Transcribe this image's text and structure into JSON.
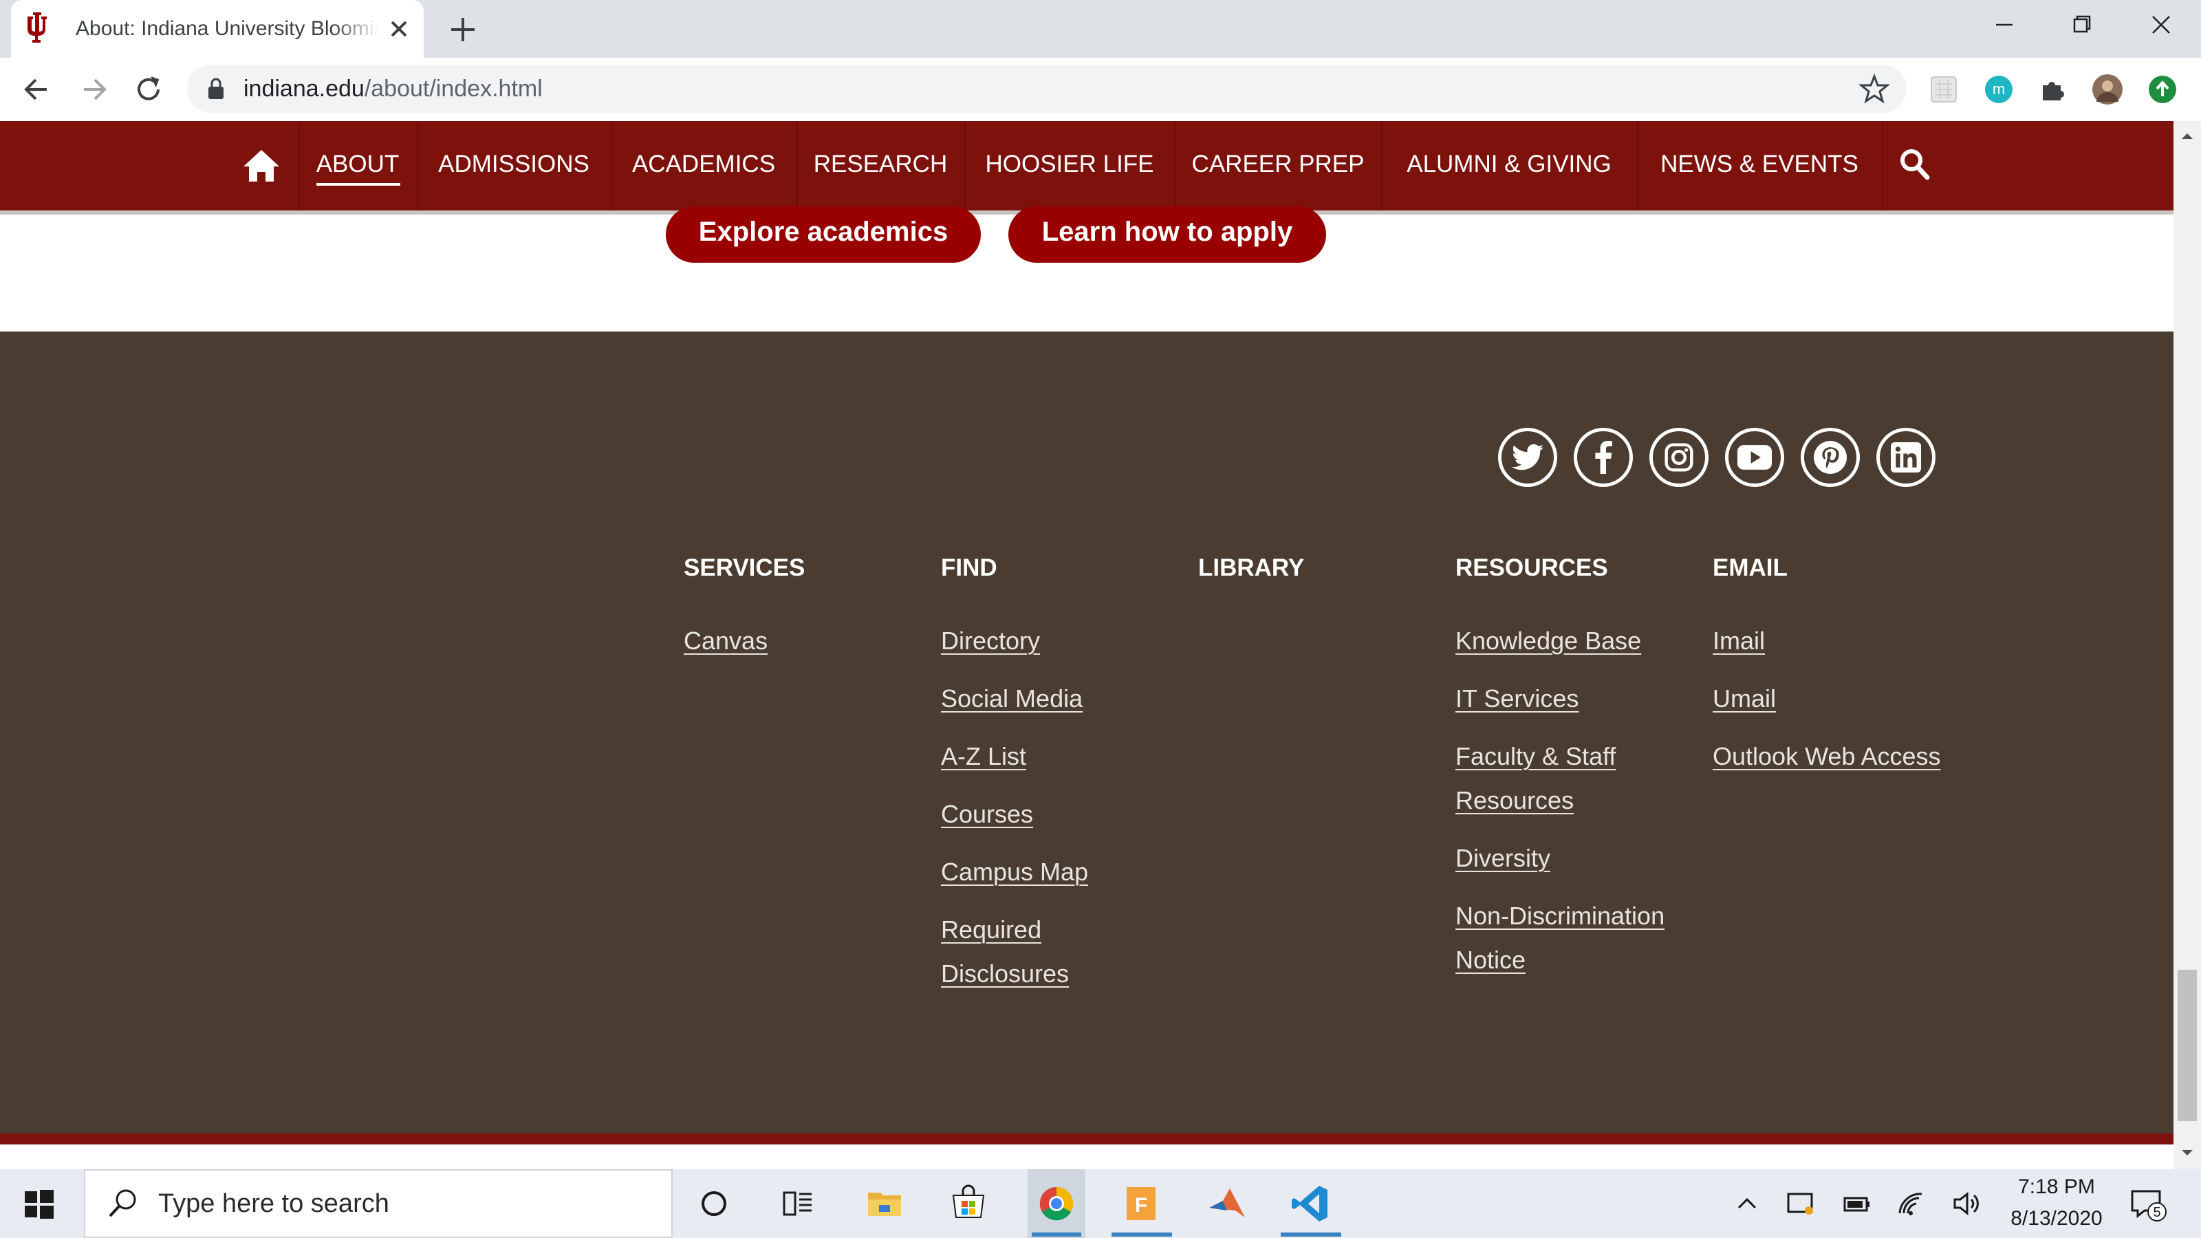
{
  "browser": {
    "tab_title": "About: Indiana University Bloomington",
    "url_domain": "indiana.edu",
    "url_path": "/about/index.html"
  },
  "site_nav": {
    "items": [
      "ABOUT",
      "ADMISSIONS",
      "ACADEMICS",
      "RESEARCH",
      "HOOSIER LIFE",
      "CAREER PREP",
      "ALUMNI & GIVING",
      "NEWS & EVENTS"
    ],
    "active": "ABOUT",
    "brand_color": "#7d110c"
  },
  "cta": {
    "explore": "Explore academics",
    "apply": "Learn how to apply"
  },
  "footer": {
    "background": "#4a3c31",
    "social": [
      "twitter-icon",
      "facebook-icon",
      "instagram-icon",
      "youtube-icon",
      "pinterest-icon",
      "linkedin-icon"
    ],
    "columns": [
      {
        "heading": "SERVICES",
        "links": [
          "Canvas"
        ]
      },
      {
        "heading": "FIND",
        "links": [
          "Directory",
          "Social Media",
          "A-Z List",
          "Courses",
          "Campus Map",
          "Required",
          "Disclosures"
        ]
      },
      {
        "heading": "LIBRARY",
        "links": []
      },
      {
        "heading": "RESOURCES",
        "links": [
          "Knowledge Base",
          "IT Services",
          "Faculty & Staff",
          "Resources",
          "Diversity",
          "Non-Discrimination",
          "Notice"
        ]
      },
      {
        "heading": "EMAIL",
        "links": [
          "Imail",
          "Umail",
          "Outlook Web Access"
        ]
      }
    ]
  },
  "taskbar": {
    "search_placeholder": "Type here to search",
    "time": "7:18 PM",
    "date": "8/13/2020",
    "notifications": "5"
  }
}
